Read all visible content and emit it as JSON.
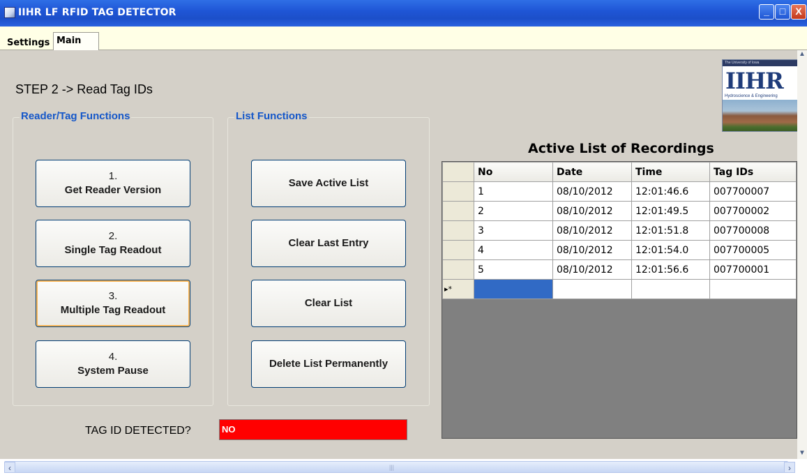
{
  "window": {
    "title": "IIHR LF RFID TAG DETECTOR",
    "min_symbol": "_",
    "max_symbol": "□",
    "close_symbol": "X"
  },
  "tabs": [
    {
      "label": "Settings"
    },
    {
      "label": "Main"
    }
  ],
  "main": {
    "step_title": "STEP 2 -> Read Tag IDs",
    "reader_group": {
      "title": "Reader/Tag Functions",
      "buttons": [
        {
          "number": "1.",
          "label": "Get Reader Version"
        },
        {
          "number": "2.",
          "label": "Single Tag Readout"
        },
        {
          "number": "3.",
          "label": "Multiple Tag Readout"
        },
        {
          "number": "4.",
          "label": "System Pause"
        }
      ]
    },
    "list_group": {
      "title": "List Functions",
      "buttons": [
        {
          "label": "Save Active List"
        },
        {
          "label": "Clear Last Entry"
        },
        {
          "label": "Clear List"
        },
        {
          "label": "Delete List Permanently"
        }
      ]
    },
    "tag_detected": {
      "label": "TAG ID DETECTED?",
      "value": "NO",
      "color": "#ff0000"
    }
  },
  "logo": {
    "top_text": "The University of Iowa",
    "letters": "IIHR",
    "subtitle": "Hydroscience & Engineering"
  },
  "grid": {
    "title": "Active List of Recordings",
    "columns": [
      "No",
      "Date",
      "Time",
      "Tag IDs"
    ],
    "rows": [
      [
        "1",
        "08/10/2012",
        "12:01:46.6",
        "007700007"
      ],
      [
        "2",
        "08/10/2012",
        "12:01:49.5",
        "007700002"
      ],
      [
        "3",
        "08/10/2012",
        "12:01:51.8",
        "007700008"
      ],
      [
        "4",
        "08/10/2012",
        "12:01:54.0",
        "007700005"
      ],
      [
        "5",
        "08/10/2012",
        "12:01:56.6",
        "007700001"
      ]
    ],
    "new_row_marker": "▸*"
  },
  "colors": {
    "group_title": "#1557c9",
    "title_bar": "#1f56d6",
    "selection": "#316ac5"
  }
}
